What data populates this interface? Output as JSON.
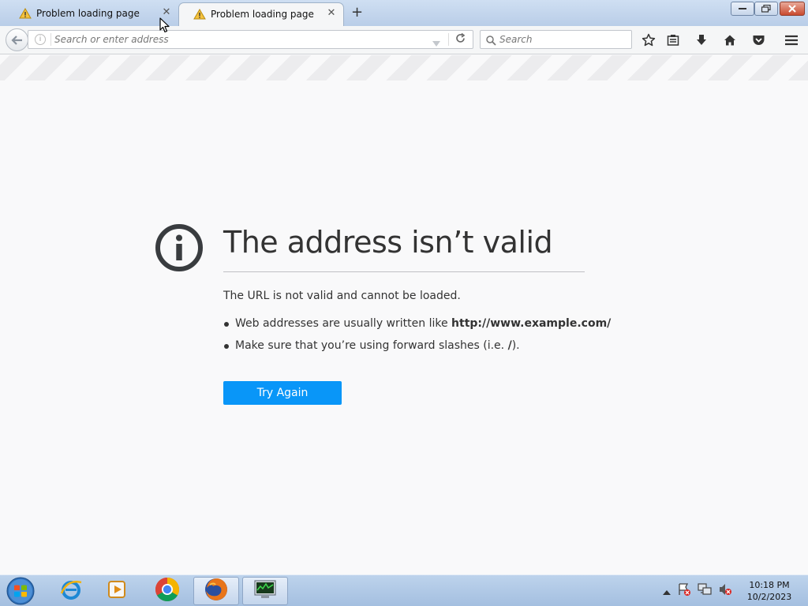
{
  "tabs": [
    {
      "label": "Problem loading page",
      "active": false
    },
    {
      "label": "Problem loading page",
      "active": true
    }
  ],
  "navbar": {
    "url_placeholder": "Search or enter address",
    "search_placeholder": "Search"
  },
  "error": {
    "title": "The address isn’t valid",
    "description": "The URL is not valid and cannot be loaded.",
    "bullet1_text": "Web addresses are usually written like ",
    "bullet1_bold": "http://www.example.com/",
    "bullet2_text": "Make sure that you’re using forward slashes (i.e. ",
    "bullet2_bold": "/",
    "bullet2_end": ").",
    "button_label": "Try Again"
  },
  "taskbar": {
    "apps": [
      "internet-explorer",
      "media-player",
      "chrome",
      "firefox",
      "task-manager"
    ],
    "clock_time": "10:18 PM",
    "clock_date": "10/2/2023"
  },
  "colors": {
    "accent": "#0996f8",
    "page_bg": "#f9f9fa",
    "text": "#333333"
  }
}
